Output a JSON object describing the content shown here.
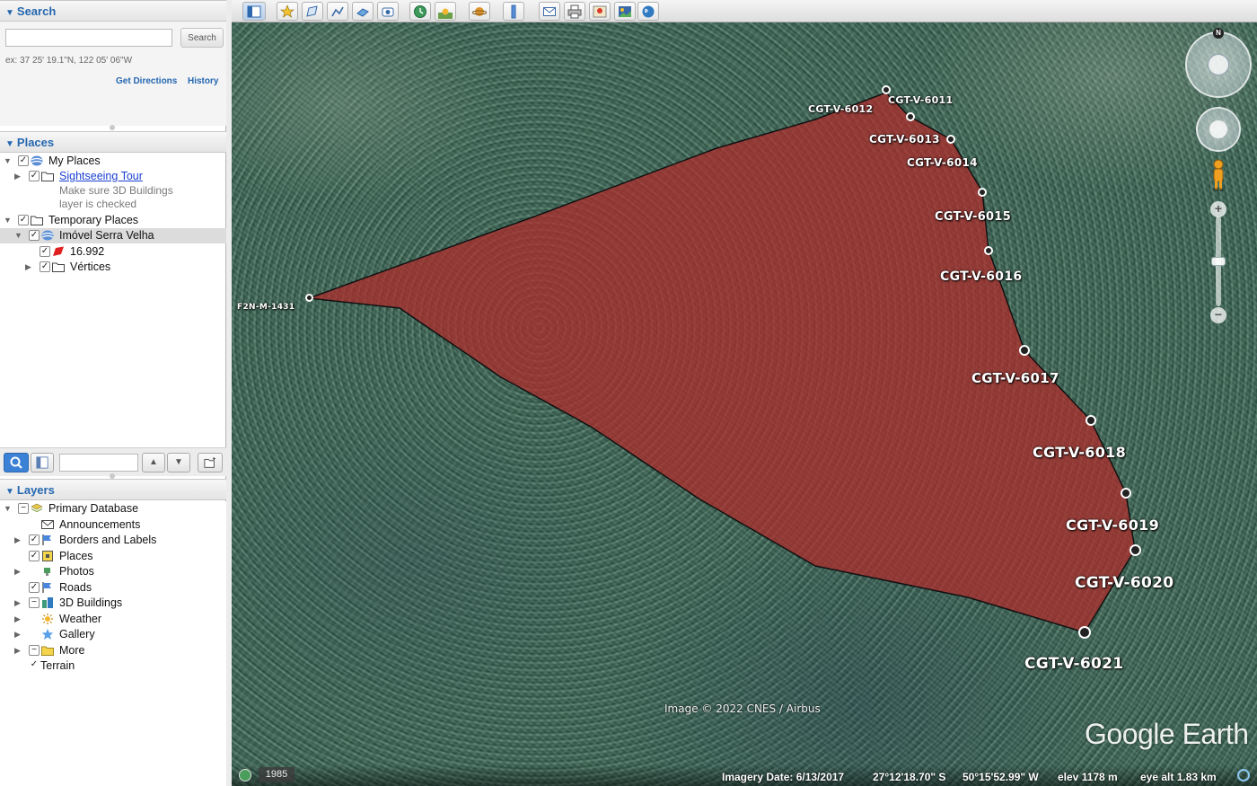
{
  "search": {
    "title": "Search",
    "placeholder": "",
    "button": "Search",
    "example": "ex: 37 25' 19.1\"N, 122 05' 06\"W",
    "get_directions": "Get Directions",
    "history": "History"
  },
  "places": {
    "title": "Places",
    "my_places": "My Places",
    "sightseeing": "Sightseeing Tour",
    "sightseeing_desc_1": "Make sure 3D Buildings",
    "sightseeing_desc_2": "layer is checked",
    "temporary": "Temporary Places",
    "imovel": "Imóvel Serra Velha",
    "polygon": "16.992",
    "vertices": "Vértices"
  },
  "layers": {
    "title": "Layers",
    "items": [
      {
        "label": "Primary Database",
        "checked": "−"
      },
      {
        "label": "Announcements",
        "checked": ""
      },
      {
        "label": "Borders and Labels",
        "checked": "✓"
      },
      {
        "label": "Places",
        "checked": "✓"
      },
      {
        "label": "Photos",
        "checked": ""
      },
      {
        "label": "Roads",
        "checked": "✓"
      },
      {
        "label": "3D Buildings",
        "checked": "−"
      },
      {
        "label": "Weather",
        "checked": ""
      },
      {
        "label": "Gallery",
        "checked": ""
      },
      {
        "label": "More",
        "checked": "−"
      },
      {
        "label": "Terrain",
        "checked": "✓"
      }
    ]
  },
  "map": {
    "polygon_fill": "#b02a2a",
    "vertices": [
      {
        "label": "CGT-V-6011"
      },
      {
        "label": "CGT-V-6012"
      },
      {
        "label": "CGT-V-6013"
      },
      {
        "label": "CGT-V-6014"
      },
      {
        "label": "CGT-V-6015"
      },
      {
        "label": "CGT-V-6016"
      },
      {
        "label": "CGT-V-6017"
      },
      {
        "label": "CGT-V-6018"
      },
      {
        "label": "CGT-V-6019"
      },
      {
        "label": "CGT-V-6020"
      },
      {
        "label": "CGT-V-6021"
      },
      {
        "label": "F2N-M-1431"
      }
    ],
    "attribution": "Image © 2022 CNES / Airbus",
    "brand": "Google Earth",
    "compass_north": "N"
  },
  "status": {
    "historical_year": "1985",
    "imagery_date": "Imagery Date: 6/13/2017",
    "latitude": "27°12'18.70\" S",
    "longitude": "50°15'52.99\" W",
    "elevation": "elev  1178 m",
    "eye_alt": "eye alt  1.83 km"
  }
}
